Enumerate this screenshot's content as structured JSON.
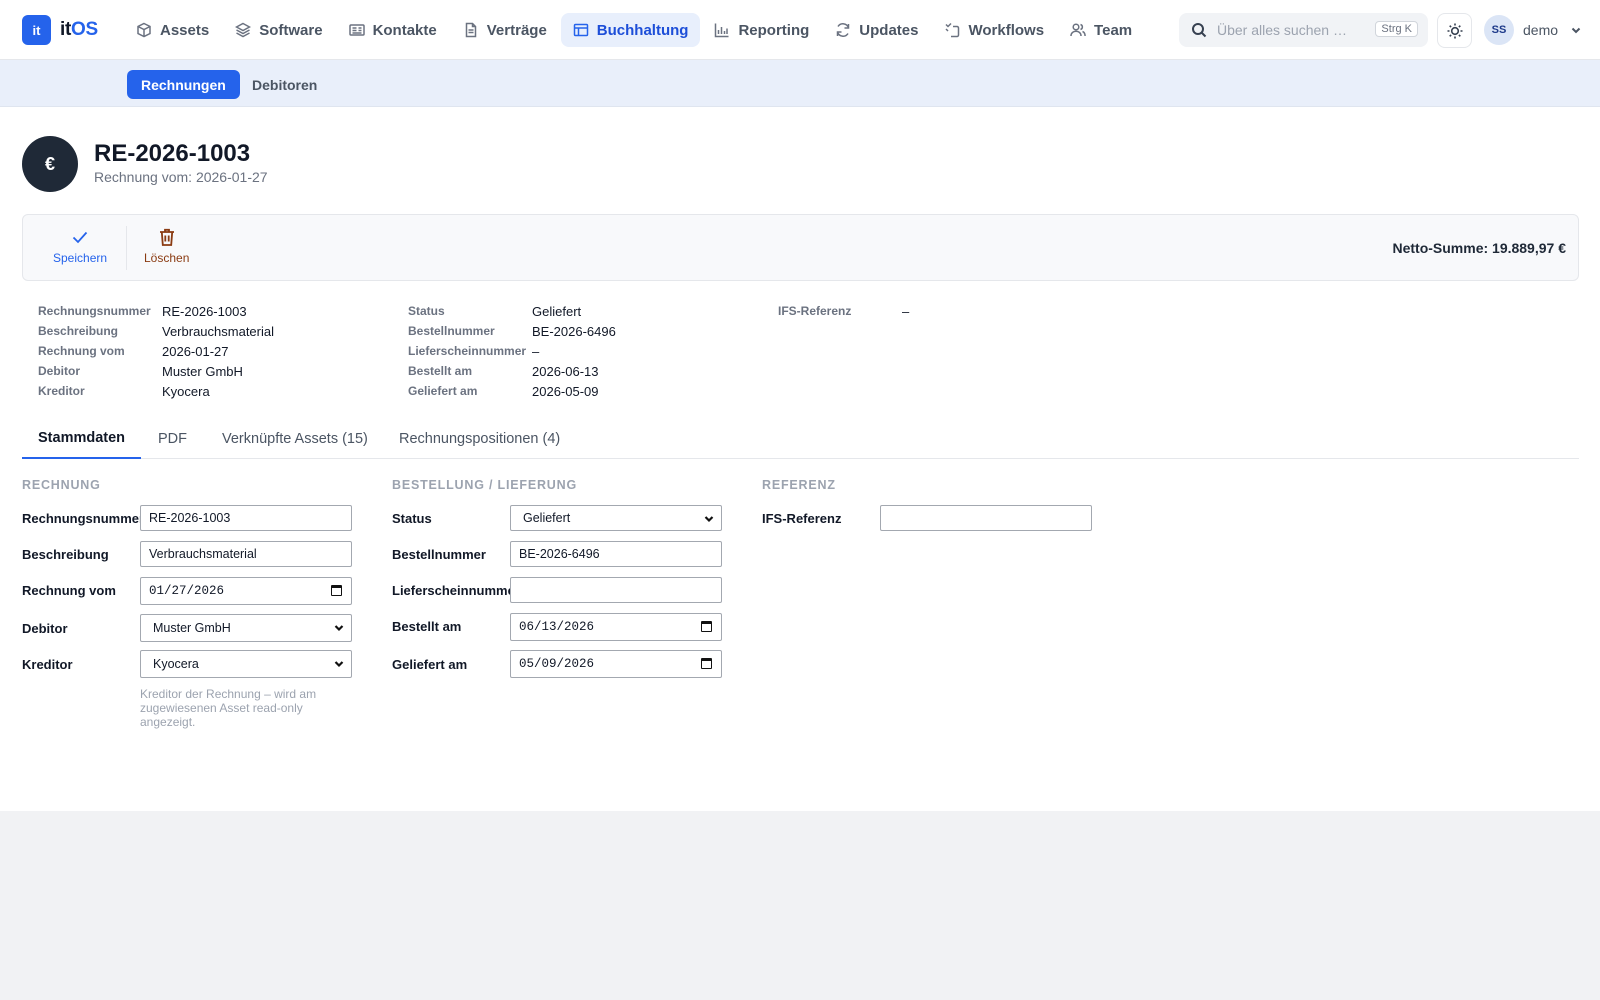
{
  "brand": {
    "logo": "it",
    "name_part1": "it",
    "name_part2": "OS"
  },
  "nav": [
    {
      "label": "Assets",
      "icon": "cube-icon"
    },
    {
      "label": "Software",
      "icon": "layers-icon"
    },
    {
      "label": "Kontakte",
      "icon": "id-card-icon"
    },
    {
      "label": "Verträge",
      "icon": "document-icon"
    },
    {
      "label": "Buchhaltung",
      "icon": "table-icon",
      "active": true
    },
    {
      "label": "Reporting",
      "icon": "bar-chart-icon"
    },
    {
      "label": "Updates",
      "icon": "refresh-icon"
    },
    {
      "label": "Workflows",
      "icon": "workflow-icon"
    },
    {
      "label": "Team",
      "icon": "users-icon"
    }
  ],
  "search": {
    "placeholder": "Über alles suchen …",
    "shortcut": "Strg K"
  },
  "user": {
    "initials": "SS",
    "name": "demo"
  },
  "subnav": {
    "invoices": "Rechnungen",
    "debtors": "Debitoren"
  },
  "header": {
    "icon": "€",
    "title": "RE-2026-1003",
    "subtitle": "Rechnung vom: 2026-01-27"
  },
  "actions": {
    "save": "Speichern",
    "delete": "Löschen",
    "net_sum": "Netto-Summe: 19.889,97 €"
  },
  "summary": {
    "col1": [
      {
        "label": "Rechnungsnummer",
        "value": "RE-2026-1003"
      },
      {
        "label": "Beschreibung",
        "value": "Verbrauchsmaterial"
      },
      {
        "label": "Rechnung vom",
        "value": "2026-01-27"
      },
      {
        "label": "Debitor",
        "value": "Muster GmbH"
      },
      {
        "label": "Kreditor",
        "value": "Kyocera"
      }
    ],
    "col2": [
      {
        "label": "Status",
        "value": "Geliefert"
      },
      {
        "label": "Bestellnummer",
        "value": "BE-2026-6496"
      },
      {
        "label": "Lieferscheinnummer",
        "value": "–"
      },
      {
        "label": "Bestellt am",
        "value": "2026-06-13"
      },
      {
        "label": "Geliefert am",
        "value": "2026-05-09"
      }
    ],
    "col3": [
      {
        "label": "IFS-Referenz",
        "value": "–"
      }
    ]
  },
  "tabs": [
    "Stammdaten",
    "PDF",
    "Verknüpfte Assets (15)",
    "Rechnungspositionen (4)"
  ],
  "form": {
    "section_invoice": "RECHNUNG",
    "section_order": "BESTELLUNG / LIEFERUNG",
    "section_ref": "REFERENZ",
    "invoice_number": {
      "label": "Rechnungsnummer",
      "value": "RE-2026-1003"
    },
    "description": {
      "label": "Beschreibung",
      "value": "Verbrauchsmaterial"
    },
    "invoice_date": {
      "label": "Rechnung vom",
      "value": "01/27/2026"
    },
    "debtor": {
      "label": "Debitor",
      "value": "Muster GmbH"
    },
    "creditor": {
      "label": "Kreditor",
      "value": "Kyocera"
    },
    "creditor_hint": "Kreditor der Rechnung – wird am zugewiesenen Asset read-only angezeigt.",
    "status": {
      "label": "Status",
      "value": "Geliefert"
    },
    "order_number": {
      "label": "Bestellnummer",
      "value": "BE-2026-6496"
    },
    "delivery_note": {
      "label": "Lieferscheinnummer",
      "value": ""
    },
    "ordered_on": {
      "label": "Bestellt am",
      "value": "06/13/2026"
    },
    "delivered_on": {
      "label": "Geliefert am",
      "value": "05/09/2026"
    },
    "ifs_ref": {
      "label": "IFS-Referenz",
      "value": ""
    }
  },
  "colors": {
    "accent": "#2563eb",
    "dark": "#1f2937",
    "danger": "#8a3b12"
  }
}
